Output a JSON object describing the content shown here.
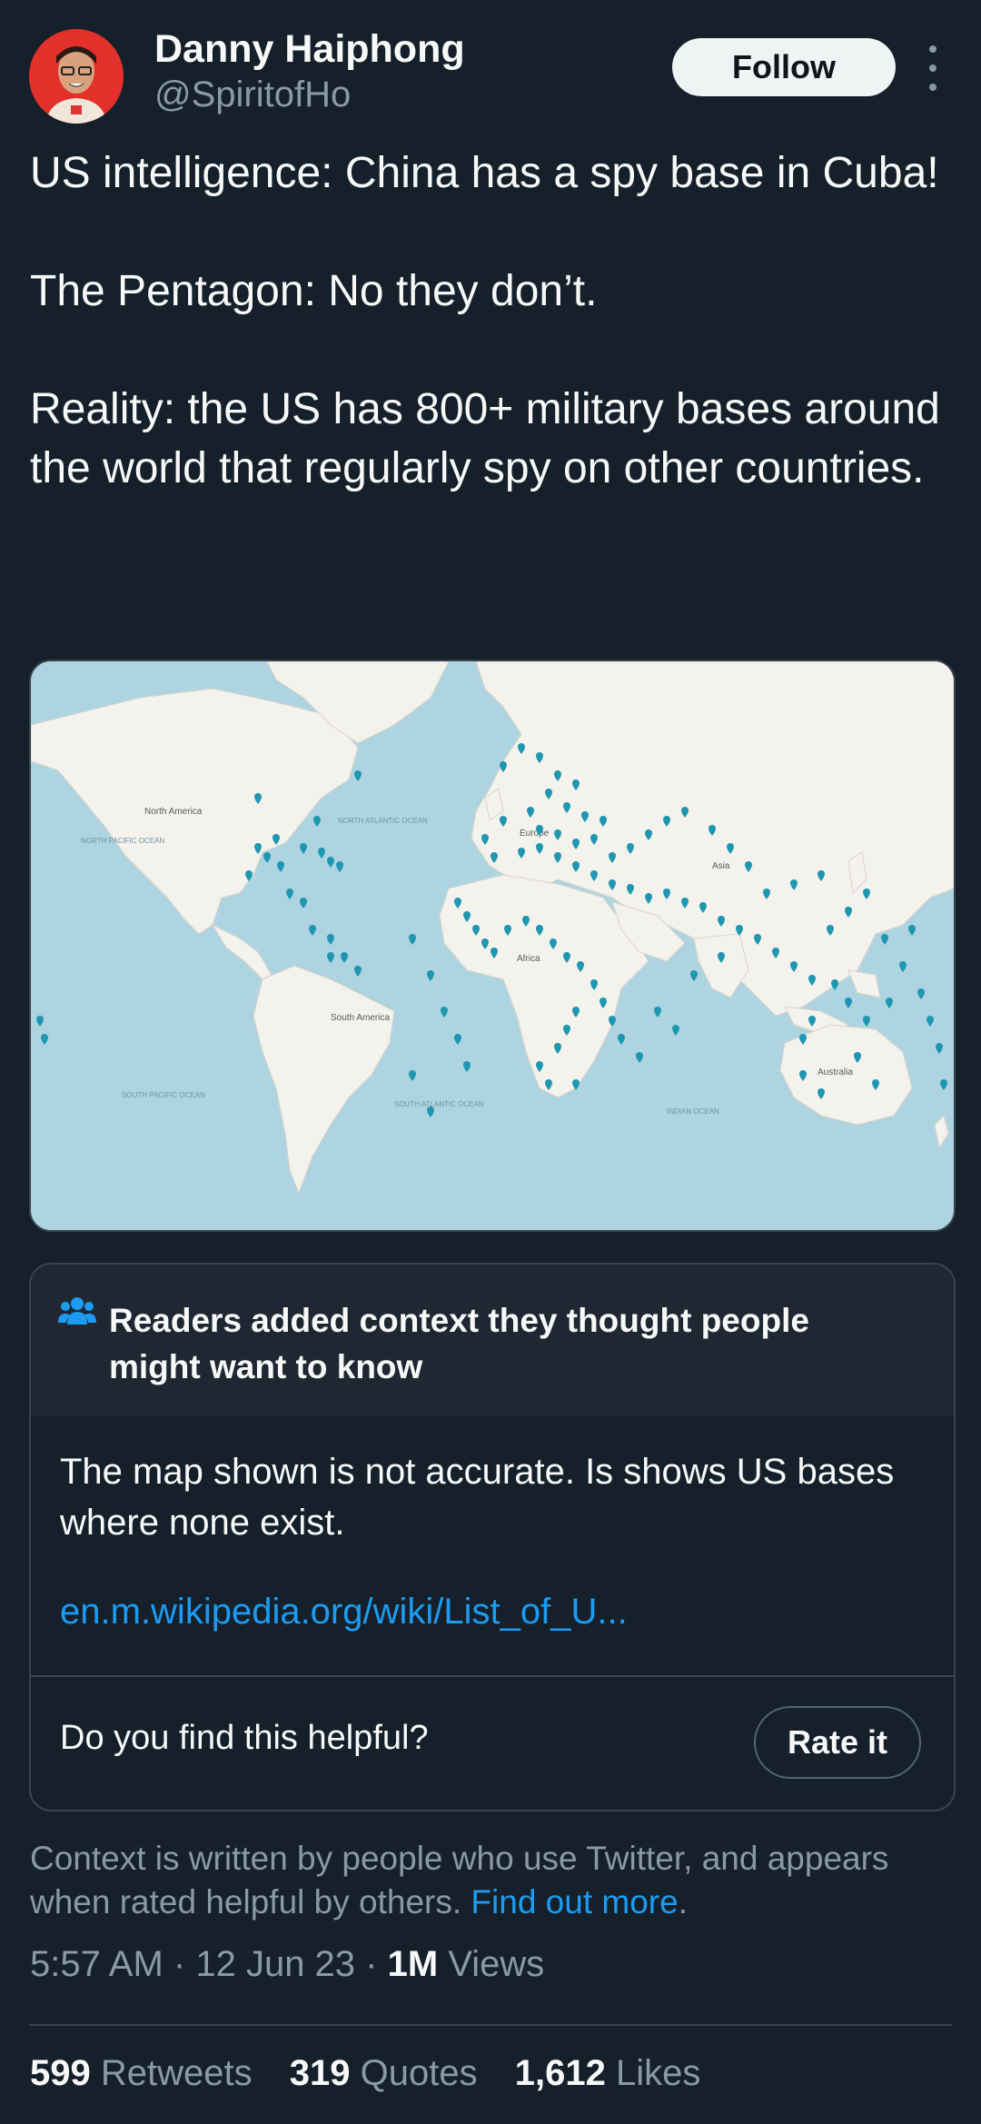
{
  "author": {
    "name": "Danny Haiphong",
    "handle": "@SpiritofHo"
  },
  "actions": {
    "follow_label": "Follow",
    "more_icon": "more-vertical-icon"
  },
  "tweet": {
    "lines": [
      "US intelligence: China has a spy base in Cuba!",
      "The Pentagon: No they don’t.",
      "Reality: the US has 800+ military bases around the world that regularly spy on other countries."
    ]
  },
  "map": {
    "labels": {
      "north_america": "North America",
      "north_atlantic": "NORTH ATLANTIC OCEAN",
      "north_pacific": "NORTH PACIFIC OCEAN",
      "south_america": "South America",
      "south_pacific": "SOUTH PACIFIC OCEAN",
      "south_atlantic": "SOUTH ATLANTIC OCEAN",
      "africa": "Africa",
      "asia": "Asia",
      "europe": "Europe",
      "australia": "Australia",
      "indian_ocean": "INDIAN OCEAN"
    },
    "colors": {
      "water": "#aed4e2",
      "land": "#f4f2ec",
      "marker": "#1f97b0"
    }
  },
  "community_note": {
    "title": "Readers added context they thought people might want to know",
    "icon": "people-icon",
    "body": "The map shown is not accurate. Is shows US bases where none exist.",
    "link": "en.m.wikipedia.org/wiki/List_of_U...",
    "question": "Do you find this helpful?",
    "rate_label": "Rate it"
  },
  "context": {
    "text": "Context is written by people who use Twitter, and appears when rated helpful by others.",
    "link": "Find out more",
    "period": "."
  },
  "meta": {
    "time": "5:57 AM",
    "dot1": "·",
    "date": "12 Jun 23",
    "dot2": "·",
    "views_count": "1M",
    "views_label": "Views"
  },
  "stats": {
    "retweets_count": "599",
    "retweets_label": "Retweets",
    "quotes_count": "319",
    "quotes_label": "Quotes",
    "likes_count": "1,612",
    "likes_label": "Likes"
  }
}
